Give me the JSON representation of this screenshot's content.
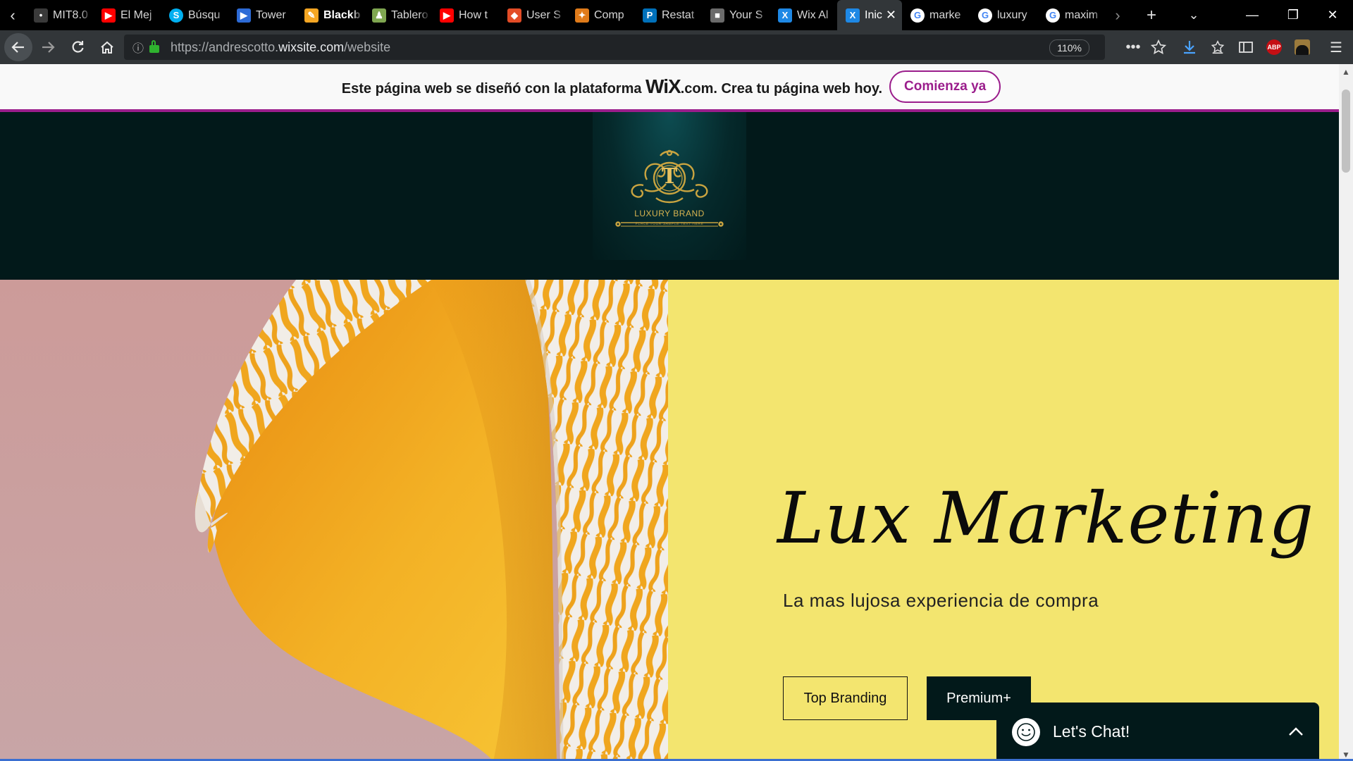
{
  "browser": {
    "tabs": [
      {
        "label": "MIT8.0",
        "icon": "generic-tab-icon",
        "color": "#3a3a3a"
      },
      {
        "label": "El Mej",
        "icon": "youtube-icon",
        "color": "#ff0000"
      },
      {
        "label": "Búsqu",
        "icon": "skype-icon",
        "color": "#00aff0"
      },
      {
        "label": "Tower",
        "icon": "video-play-icon",
        "color": "#2d6bd6"
      },
      {
        "label": "Blackb",
        "icon": "pencil-icon",
        "color": "#f5a623"
      },
      {
        "label": "Tablero",
        "icon": "chess-icon",
        "color": "#7fa650"
      },
      {
        "label": "How t",
        "icon": "youtube-icon",
        "color": "#ff0000"
      },
      {
        "label": "User S",
        "icon": "diamond-icon",
        "color": "#e34c26"
      },
      {
        "label": "Comp",
        "icon": "mario-icon",
        "color": "#e07b1a"
      },
      {
        "label": "Restat",
        "icon": "paypal-icon",
        "color": "#0070ba"
      },
      {
        "label": "Your S",
        "icon": "box-icon",
        "color": "#6b6b6b"
      },
      {
        "label": "Wix Al",
        "icon": "wix-icon",
        "color": "#1e88e5"
      },
      {
        "label": "Inic",
        "icon": "wix-icon",
        "color": "#1e88e5"
      },
      {
        "label": "marke",
        "icon": "google-icon",
        "color": "#4285f4"
      },
      {
        "label": "luxury",
        "icon": "google-icon",
        "color": "#4285f4"
      },
      {
        "label": "maxim",
        "icon": "google-icon",
        "color": "#4285f4"
      }
    ],
    "active_tab_index": 12,
    "url_prefix": "https://andrescotto.",
    "url_host": "wixsite.com",
    "url_path": "/website",
    "zoom": "110%",
    "abp_label": "ABP"
  },
  "wix_banner": {
    "text_before": "Este página web se diseñó con la plataforma",
    "brand": "WiX",
    "brand_suffix": ".com. Crea tu página web hoy.",
    "cta": "Comienza ya",
    "accent_color": "#9b1e8c"
  },
  "site": {
    "logo": {
      "initial": "T",
      "name": "LUXURY BRAND",
      "tagline": "PLACE YOUR SAMPLE TEXT HERE"
    },
    "hero": {
      "title": "Lux Marketing",
      "subtitle": "La mas lujosa experiencia de compra",
      "button_primary": "Top Branding",
      "button_secondary": "Premium+"
    },
    "chat": {
      "label": "Let's Chat!"
    },
    "colors": {
      "header_bg": "#02191a",
      "hero_right_bg": "#f3e56f",
      "hero_left_bg": "#cc9b99",
      "gold": "#c9a440",
      "ribbon_orange": "#f0a820"
    }
  }
}
